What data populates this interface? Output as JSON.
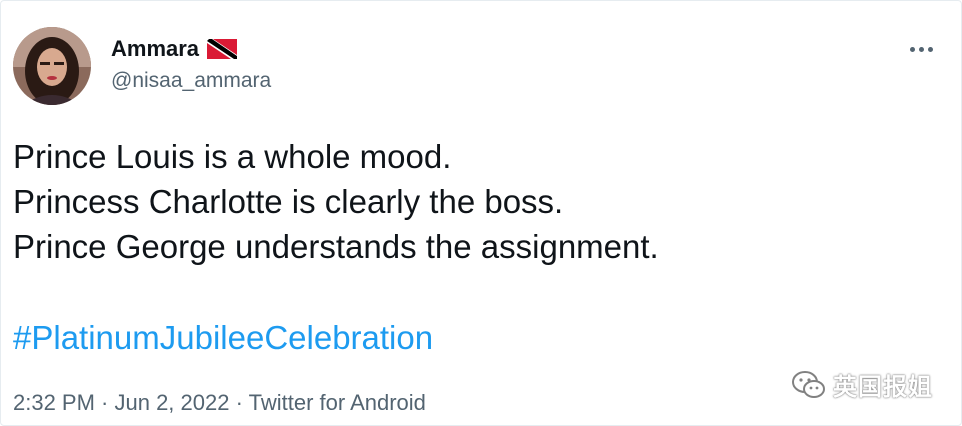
{
  "tweet": {
    "display_name": "Ammara",
    "handle": "@nisaa_ammara",
    "flag_icon": "trinidad-and-tobago-flag-icon",
    "more_icon": "more-options-icon",
    "text_lines": [
      "Prince Louis is a whole mood.",
      "Princess Charlotte is clearly the boss.",
      "Prince George understands the assignment."
    ],
    "hashtag": "#PlatinumJubileeCelebration",
    "meta": "2:32 PM · Jun 2, 2022 · Twitter for Android"
  },
  "watermark": {
    "icon": "wechat-icon",
    "text": "英国报姐"
  },
  "colors": {
    "text": "#0f1419",
    "secondary": "#536471",
    "link": "#1d9bf0",
    "flag_red": "#da1a35",
    "flag_black": "#000000"
  }
}
